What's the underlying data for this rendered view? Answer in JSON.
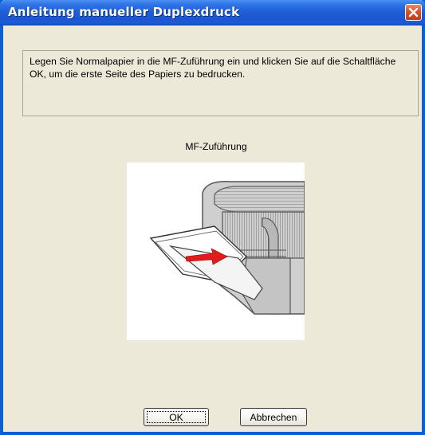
{
  "window": {
    "title": "Anleitung manueller Duplexdruck"
  },
  "message": {
    "text": "Legen Sie Normalpapier in die MF-Zuführung ein und klicken Sie auf die Schaltfläche OK, um die erste Seite des Papiers zu bedrucken."
  },
  "illustration": {
    "label": "MF-Zuführung"
  },
  "buttons": {
    "ok": "OK",
    "cancel": "Abbrechen"
  },
  "colors": {
    "titlebar": "#1f5fd8",
    "window_bg": "#ece9d8",
    "close_button": "#d9532b",
    "arrow": "#e21c1c"
  },
  "icons": {
    "close": "close-icon"
  }
}
